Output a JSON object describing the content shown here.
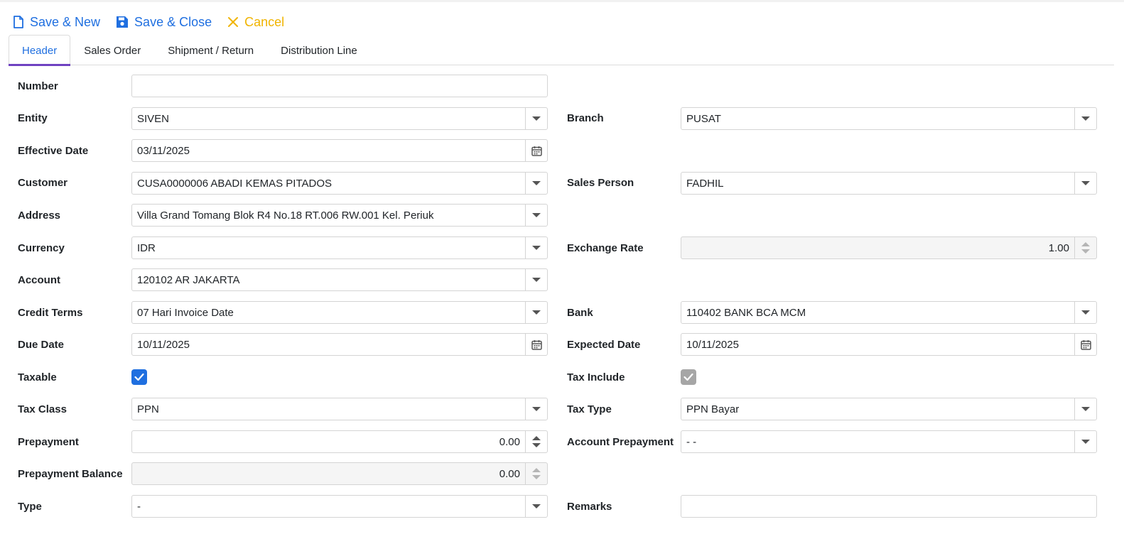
{
  "toolbar": {
    "save_new": "Save & New",
    "save_close": "Save & Close",
    "cancel": "Cancel"
  },
  "tabs": [
    "Header",
    "Sales Order",
    "Shipment / Return",
    "Distribution Line"
  ],
  "form": {
    "number": {
      "label": "Number",
      "value": ""
    },
    "entity": {
      "label": "Entity",
      "value": "SIVEN"
    },
    "branch": {
      "label": "Branch",
      "value": "PUSAT"
    },
    "effective_date": {
      "label": "Effective Date",
      "value": "03/11/2025"
    },
    "customer": {
      "label": "Customer",
      "value": "CUSA0000006 ABADI KEMAS PITADOS"
    },
    "sales_person": {
      "label": "Sales Person",
      "value": "FADHIL"
    },
    "address": {
      "label": "Address",
      "value": "Villa Grand Tomang Blok R4 No.18 RT.006 RW.001 Kel. Periuk"
    },
    "currency": {
      "label": "Currency",
      "value": "IDR"
    },
    "exchange_rate": {
      "label": "Exchange Rate",
      "value": "1.00"
    },
    "account": {
      "label": "Account",
      "value": "120102 AR JAKARTA"
    },
    "credit_terms": {
      "label": "Credit Terms",
      "value": "07 Hari Invoice Date"
    },
    "bank": {
      "label": "Bank",
      "value": "110402 BANK BCA MCM"
    },
    "due_date": {
      "label": "Due Date",
      "value": "10/11/2025"
    },
    "expected_date": {
      "label": "Expected Date",
      "value": "10/11/2025"
    },
    "taxable": {
      "label": "Taxable",
      "checked": true
    },
    "tax_include": {
      "label": "Tax Include",
      "checked": true
    },
    "tax_class": {
      "label": "Tax Class",
      "value": "PPN"
    },
    "tax_type": {
      "label": "Tax Type",
      "value": "PPN Bayar"
    },
    "prepayment": {
      "label": "Prepayment",
      "value": "0.00"
    },
    "account_prepayment": {
      "label": "Account Prepayment",
      "value": "- -"
    },
    "prepayment_balance": {
      "label": "Prepayment Balance",
      "value": "0.00"
    },
    "type": {
      "label": "Type",
      "value": "-"
    },
    "remarks": {
      "label": "Remarks",
      "value": ""
    }
  },
  "colors": {
    "accent": "#1f6fe0",
    "cancel": "#f0b400",
    "tab_indicator": "#6f42c1"
  }
}
